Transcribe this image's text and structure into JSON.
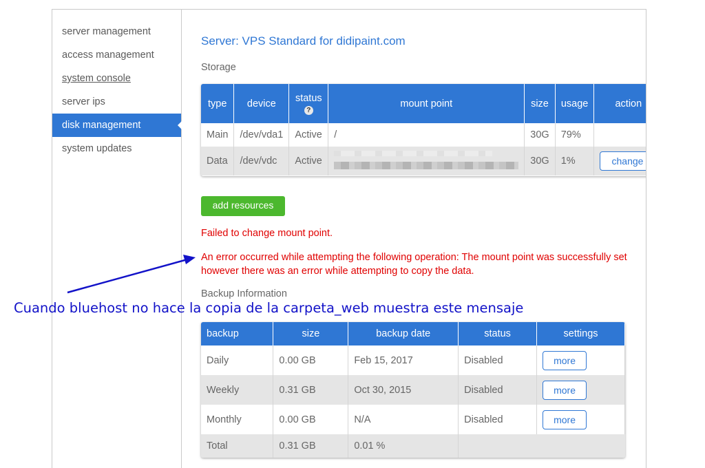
{
  "sidebar": {
    "items": [
      {
        "label": "server management"
      },
      {
        "label": "access management"
      },
      {
        "label": "system console"
      },
      {
        "label": "server ips"
      },
      {
        "label": "disk management"
      },
      {
        "label": "system updates"
      }
    ]
  },
  "page": {
    "title": "Server: VPS Standard for didipaint.com",
    "storage_label": "Storage",
    "backup_label": "Backup Information",
    "add_resources_label": "add resources"
  },
  "storage": {
    "headers": {
      "type": "type",
      "device": "device",
      "status": "status",
      "mount_point": "mount point",
      "size": "size",
      "usage": "usage",
      "action": "action"
    },
    "help_icon": "?",
    "rows": [
      {
        "type": "Main",
        "device": "/dev/vda1",
        "status": "Active",
        "mount_point": "/",
        "size": "30G",
        "usage": "79%",
        "action": ""
      },
      {
        "type": "Data",
        "device": "/dev/vdc",
        "status": "Active",
        "mount_point": "",
        "size": "30G",
        "usage": "1%",
        "action": "change"
      }
    ]
  },
  "errors": {
    "short": "Failed to change mount point.",
    "detail": "An error occurred while attempting the following operation: The mount point was successfully set however there was an error while attempting to copy the data."
  },
  "backup": {
    "headers": {
      "backup": "backup",
      "size": "size",
      "date": "backup date",
      "status": "status",
      "settings": "settings"
    },
    "rows": [
      {
        "backup": "Daily",
        "size": "0.00 GB",
        "date": "Feb 15, 2017",
        "status": "Disabled",
        "settings": "more"
      },
      {
        "backup": "Weekly",
        "size": "0.31 GB",
        "date": "Oct 30, 2015",
        "status": "Disabled",
        "settings": "more"
      },
      {
        "backup": "Monthly",
        "size": "0.00 GB",
        "date": "N/A",
        "status": "Disabled",
        "settings": "more"
      }
    ],
    "total": {
      "label": "Total",
      "size": "0.31 GB",
      "percent": "0.01 %"
    }
  },
  "annotation": {
    "text": "Cuando bluehost no hace la copia de la carpeta_web muestra este mensaje"
  },
  "colors": {
    "accent": "#2f77d4",
    "success": "#4cb82e",
    "error": "#e00000",
    "annotation": "#1212c8"
  }
}
